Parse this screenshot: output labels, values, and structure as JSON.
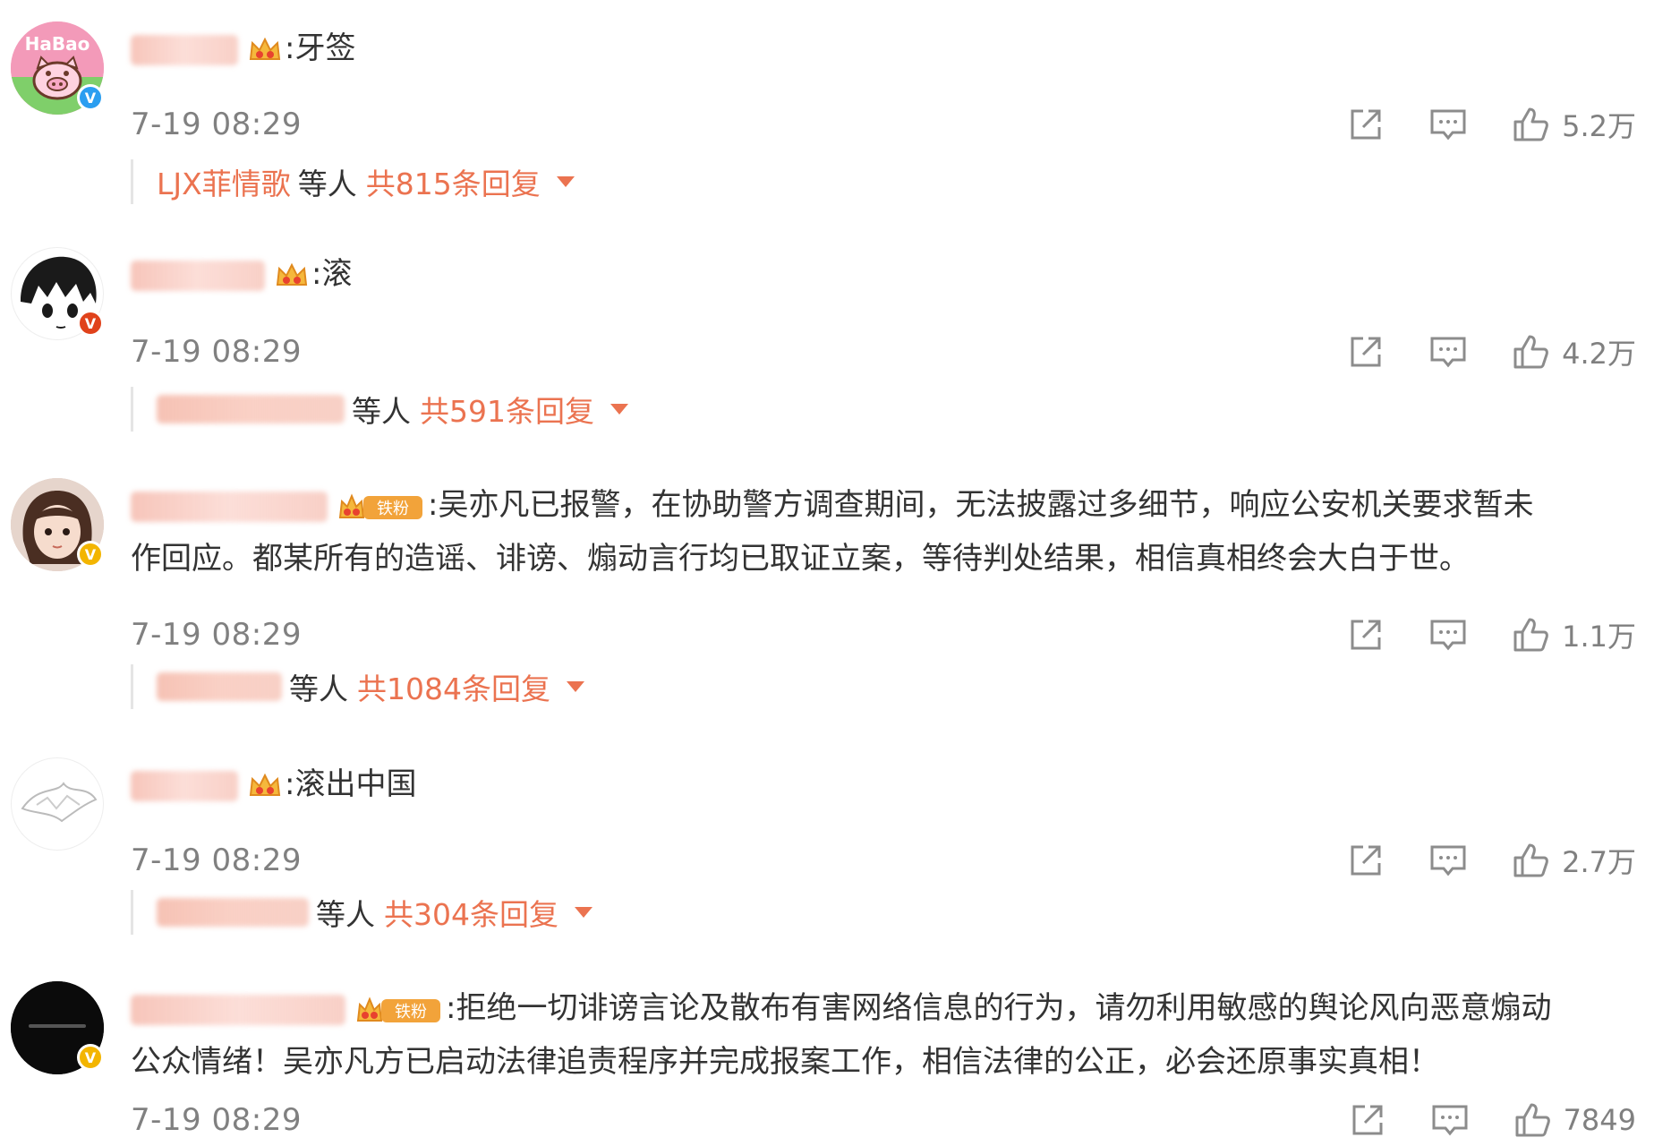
{
  "colors": {
    "accent": "#eb7350",
    "meta": "#808080",
    "text": "#333333"
  },
  "comments": [
    {
      "avatar_label": "HaBao",
      "badge": "V",
      "badge_type": "blue",
      "has_tiefen": false,
      "text": ":牙签",
      "time": "7-19 08:29",
      "likes": "5.2万",
      "replies": {
        "named_user": "LJX菲情歌",
        "others": "等人",
        "count": "共815条回复"
      }
    },
    {
      "avatar_label": "",
      "badge": "V",
      "badge_type": "red",
      "has_tiefen": false,
      "text": ":滚",
      "time": "7-19 08:29",
      "likes": "4.2万",
      "replies": {
        "named_user": "",
        "others": "等人",
        "count": "共591条回复"
      }
    },
    {
      "avatar_label": "",
      "badge": "V",
      "badge_type": "gold",
      "has_tiefen": true,
      "tiefen_label": "铁粉",
      "text": ":吴亦凡已报警，在协助警方调查期间，无法披露过多细节，响应公安机关要求暂未",
      "text2": "作回应。都某所有的造谣、诽谤、煽动言行均已取证立案，等待判处结果，相信真相终会大白于世。",
      "time": "7-19 08:29",
      "likes": "1.1万",
      "replies": {
        "named_user": "",
        "others": "等人",
        "count": "共1084条回复"
      }
    },
    {
      "avatar_label": "",
      "badge": "",
      "badge_type": "",
      "has_tiefen": false,
      "text": ":滚出中国",
      "time": "7-19 08:29",
      "likes": "2.7万",
      "replies": {
        "named_user": "",
        "others": "等人",
        "count": "共304条回复"
      }
    },
    {
      "avatar_label": "",
      "badge": "V",
      "badge_type": "gold",
      "has_tiefen": true,
      "tiefen_label": "铁粉",
      "text": ":拒绝一切诽谤言论及散布有害网络信息的行为，请勿利用敏感的舆论风向恶意煽动",
      "text2": "公众情绪！吴亦凡方已启动法律追责程序并完成报案工作，相信法律的公正，必会还原事实真相！",
      "time": "7-19 08:29",
      "likes": "7849"
    }
  ]
}
